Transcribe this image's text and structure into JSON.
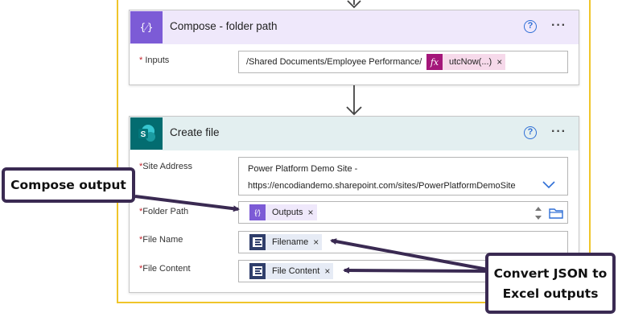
{
  "compose": {
    "title": "Compose - folder path",
    "inputs_label": "Inputs",
    "inputs_text": "/Shared Documents/Employee Performance/",
    "fx_token": "utcNow(...)",
    "fx_glyph": "fx"
  },
  "create_file": {
    "title": "Create file",
    "site_address_label": "Site Address",
    "site_address_line1": "Power Platform Demo Site -",
    "site_address_line2": "https://encodiandemo.sharepoint.com/sites/PowerPlatformDemoSite",
    "folder_path_label": "Folder Path",
    "folder_path_token": "Outputs",
    "file_name_label": "File Name",
    "file_name_token": "Filename",
    "file_content_label": "File Content",
    "file_content_token": "File Content"
  },
  "common": {
    "required_mark": "*",
    "help_glyph": "?",
    "more_glyph": "···",
    "remove_glyph": "×"
  },
  "callouts": {
    "compose_output": "Compose output",
    "convert_line1": "Convert JSON to",
    "convert_line2": "Excel outputs"
  },
  "colors": {
    "compose_header": "#efe8fb",
    "compose_icon": "#7c5bd6",
    "sharepoint_header": "#e3eff0",
    "sharepoint_icon": "#036c70",
    "fx_token_bg": "#f6d9ea",
    "fx_icon": "#a4167a",
    "encodian_icon": "#2f3e6b",
    "callout_border": "#3a2a52",
    "scope_border": "#f0c52a"
  }
}
